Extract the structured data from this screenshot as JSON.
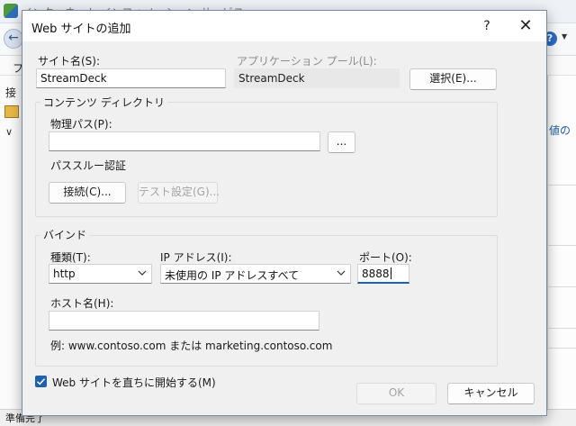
{
  "background": {
    "title_fragment": "インターネット インフォメーション サービス (IIS) マネージャー",
    "menu_fragment": "フ",
    "left_tab_fragment": "接",
    "right_link_fragment": "値の",
    "status_text": "準備完了"
  },
  "dialog": {
    "title": "Web サイトの追加",
    "help_symbol": "?",
    "close_symbol": "✕",
    "site_name": {
      "label": "サイト名(S):",
      "value": "StreamDeck"
    },
    "app_pool": {
      "label": "アプリケーション プール(L):",
      "value": "StreamDeck",
      "select_button": "選択(E)..."
    },
    "content_dir": {
      "group_title": "コンテンツ ディレクトリ",
      "physical_path_label": "物理パス(P):",
      "physical_path_value": "",
      "browse_button": "...",
      "passthrough_label": "パススルー認証",
      "connect_button": "接続(C)...",
      "test_settings_button": "テスト設定(G)..."
    },
    "binding": {
      "group_title": "バインド",
      "type_label": "種類(T):",
      "type_value": "http",
      "ip_label": "IP アドレス(I):",
      "ip_value": "未使用の IP アドレスすべて",
      "port_label": "ポート(O):",
      "port_value": "8888",
      "host_label": "ホスト名(H):",
      "host_value": "",
      "example_text": "例: www.contoso.com または marketing.contoso.com"
    },
    "start_immediately": {
      "label": "Web サイトを直ちに開始する(M)",
      "checked": true
    },
    "ok_button": "OK",
    "cancel_button": "キャンセル"
  },
  "colors": {
    "accent": "#1d5fb0",
    "dialog_bg": "#f0f0f0",
    "disabled_text": "#a3a3a3"
  },
  "icons": [
    "app-icon",
    "back-arrow-icon",
    "help-icon",
    "folder-icon",
    "chevron-down-icon",
    "checkmark-icon",
    "close-icon"
  ]
}
